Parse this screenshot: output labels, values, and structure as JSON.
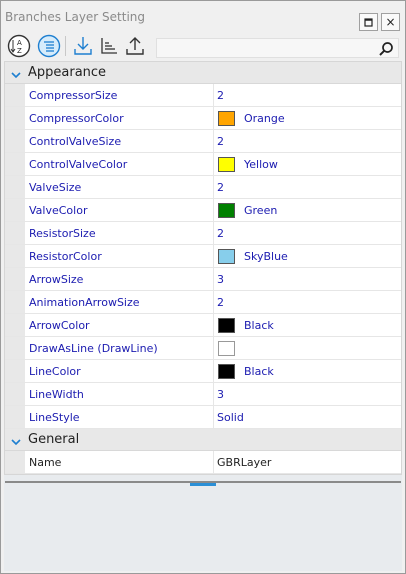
{
  "window": {
    "title": "Branches Layer Setting"
  },
  "titlebar": {
    "restore_glyph": "□",
    "close_glyph": "×"
  },
  "toolbar": {
    "icons": [
      "sort-alphabetical-icon",
      "categorized-icon",
      "import-icon",
      "sort-list-icon",
      "export-icon"
    ],
    "search": {
      "value": "",
      "placeholder": ""
    }
  },
  "sections": [
    {
      "name": "Appearance",
      "rows": [
        {
          "name": "CompressorSize",
          "value": "2"
        },
        {
          "name": "CompressorColor",
          "value": "Orange",
          "color": "#FFA500"
        },
        {
          "name": "ControlValveSize",
          "value": "2"
        },
        {
          "name": "ControlValveColor",
          "value": "Yellow",
          "color": "#FFFF00"
        },
        {
          "name": "ValveSize",
          "value": "2"
        },
        {
          "name": "ValveColor",
          "value": "Green",
          "color": "#008000"
        },
        {
          "name": "ResistorSize",
          "value": "2"
        },
        {
          "name": "ResistorColor",
          "value": "SkyBlue",
          "color": "#87CEEB"
        },
        {
          "name": "ArrowSize",
          "value": "3"
        },
        {
          "name": "AnimationArrowSize",
          "value": "2"
        },
        {
          "name": "ArrowColor",
          "value": "Black",
          "color": "#000000"
        },
        {
          "name": "DrawAsLine (DrawLine)",
          "value": "",
          "checkbox": true,
          "checked": false
        },
        {
          "name": "LineColor",
          "value": "Black",
          "color": "#000000"
        },
        {
          "name": "LineWidth",
          "value": "3"
        },
        {
          "name": "LineStyle",
          "value": "Solid"
        }
      ]
    },
    {
      "name": "General",
      "rows": [
        {
          "name": "Name",
          "value": "GBRLayer"
        }
      ]
    }
  ]
}
